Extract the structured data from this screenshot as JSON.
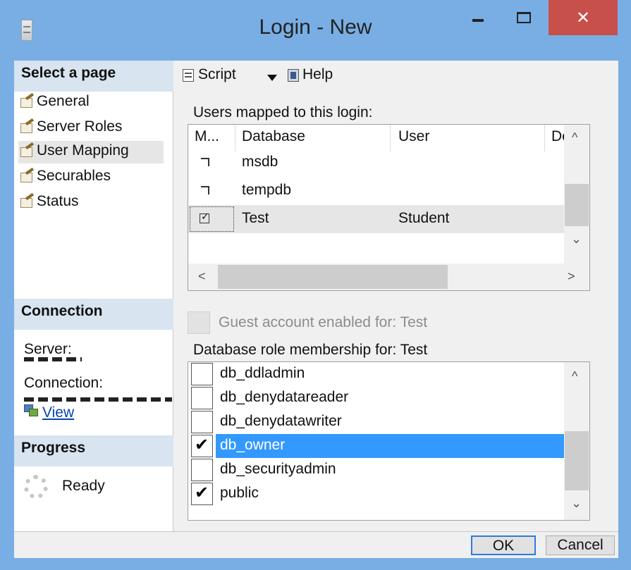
{
  "window": {
    "title": "Login - New",
    "close_glyph": "✕"
  },
  "left": {
    "select_heading": "Select a page",
    "pages": [
      "General",
      "Server Roles",
      "User Mapping",
      "Securables",
      "Status"
    ],
    "selected_page": "User Mapping",
    "connection_heading": "Connection",
    "server_label": "Server:",
    "connection_label": "Connection:",
    "view_link": "View",
    "progress_heading": "Progress",
    "progress_status": "Ready"
  },
  "toolbar": {
    "script_label": "Script",
    "help_label": "Help"
  },
  "users_grid": {
    "label": "Users mapped to this login:",
    "headers": [
      "M...",
      "Database",
      "User",
      "Defa"
    ],
    "rows": [
      {
        "database": "msdb",
        "user": "",
        "mapped": false
      },
      {
        "database": "tempdb",
        "user": "",
        "mapped": false
      },
      {
        "database": "Test",
        "user": "Student",
        "mapped": true,
        "selected": true
      }
    ],
    "scroll_up": "^",
    "scroll_down": "⌄",
    "scroll_left": "<",
    "scroll_right": ">"
  },
  "guest": {
    "label": "Guest account enabled for: Test",
    "enabled": false
  },
  "roles": {
    "label": "Database role membership for: Test",
    "items": [
      {
        "name": "db_ddladmin",
        "checked": false
      },
      {
        "name": "db_denydatareader",
        "checked": false
      },
      {
        "name": "db_denydatawriter",
        "checked": false
      },
      {
        "name": "db_owner",
        "checked": true,
        "selected": true
      },
      {
        "name": "db_securityadmin",
        "checked": false
      },
      {
        "name": "public",
        "checked": true
      }
    ]
  },
  "buttons": {
    "ok": "OK",
    "cancel": "Cancel"
  },
  "colors": {
    "titlebar": "#78aee3",
    "close": "#c7504a",
    "selection": "#3399ff",
    "link": "#0645ad"
  }
}
